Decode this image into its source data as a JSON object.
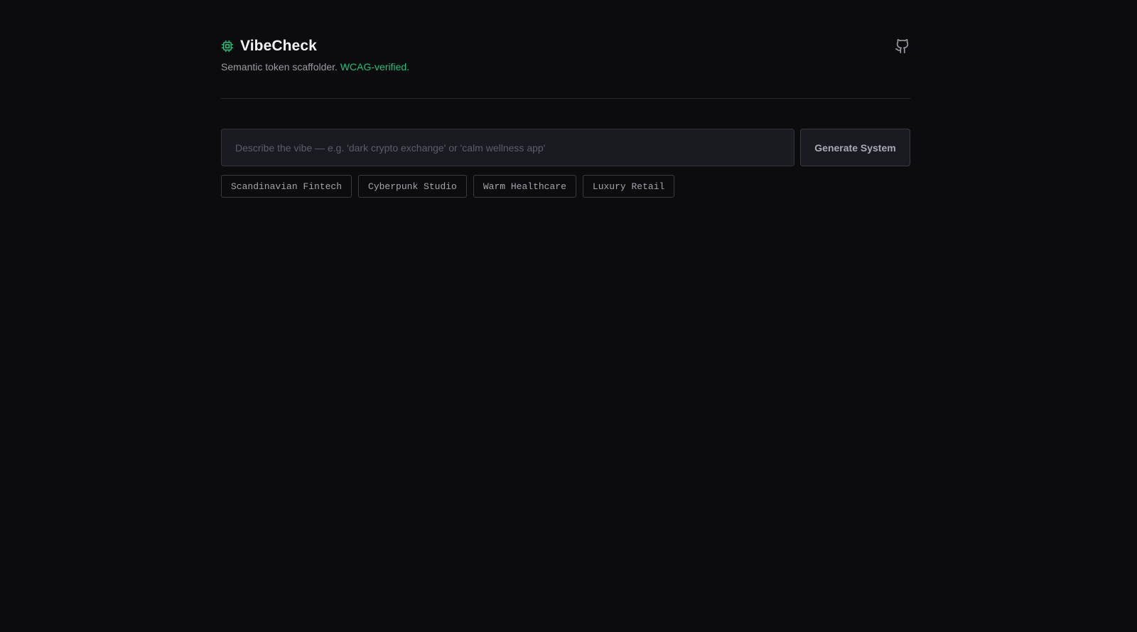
{
  "app": {
    "title": "VibeCheck",
    "tagline_prefix": "Semantic token scaffolder.",
    "tagline_accent": "WCAG-verified.",
    "logo_icon": "cpu-chip-icon",
    "github_icon": "github-icon"
  },
  "prompt": {
    "placeholder": "Describe the vibe — e.g. 'dark crypto exchange' or 'calm wellness app'",
    "value": "",
    "generate_label": "Generate System"
  },
  "presets": [
    {
      "label": "Scandinavian Fintech"
    },
    {
      "label": "Cyberpunk Studio"
    },
    {
      "label": "Warm Healthcare"
    },
    {
      "label": "Luxury Retail"
    }
  ],
  "colors": {
    "background": "#0c0c0f",
    "accent": "#22c07a",
    "text_primary": "#f2f2f4",
    "text_muted": "#9a9ba3",
    "border": "#34353c"
  }
}
